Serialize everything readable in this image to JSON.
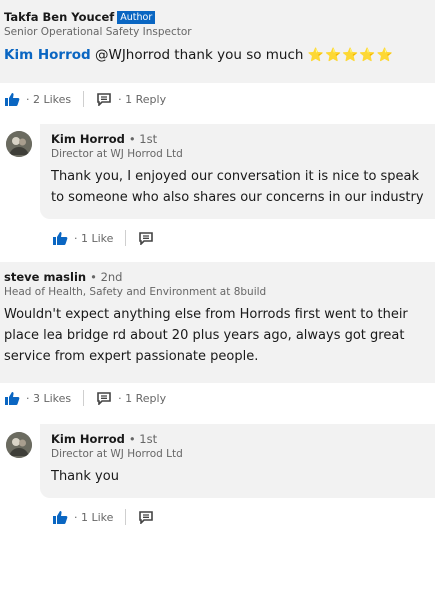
{
  "post": {
    "author_name": "Takfa Ben Youcef",
    "author_badge": "Author",
    "author_title": "Senior Operational Safety Inspector",
    "mention_name": "Kim Horrod",
    "text": " @WJhorrod  thank you so much ",
    "stars": "⭐⭐⭐⭐⭐",
    "likes_label": "· 2 Likes",
    "reply_label": "· 1 Reply"
  },
  "reply1": {
    "author_name": "Kim Horrod",
    "degree": "• 1st",
    "author_title": "Director at WJ Horrod Ltd",
    "text": "Thank you, I enjoyed our conversation it is nice to speak to someone who also shares our concerns in our industry",
    "likes_label": "· 1 Like"
  },
  "comment2": {
    "author_name": "steve maslin",
    "degree": "• 2nd",
    "author_title": "Head of Health, Safety and Environment at 8build",
    "text": "Wouldn't expect anything else from Horrods first went to their place lea bridge rd about 20 plus years ago, always got great service from expert passionate people.",
    "likes_label": "· 3 Likes",
    "reply_label": "· 1 Reply"
  },
  "reply2": {
    "author_name": "Kim Horrod",
    "degree": "• 1st",
    "author_title": "Director at WJ Horrod Ltd",
    "text": "Thank you",
    "likes_label": "· 1 Like"
  },
  "icons": {
    "like": "thumbs-up-icon",
    "reply": "reply-icon",
    "avatar": "avatar"
  },
  "colors": {
    "accent": "#0a66c2",
    "card_background": "#f2f2f2",
    "secondary_text": "#666666",
    "star": "#c9a400"
  }
}
